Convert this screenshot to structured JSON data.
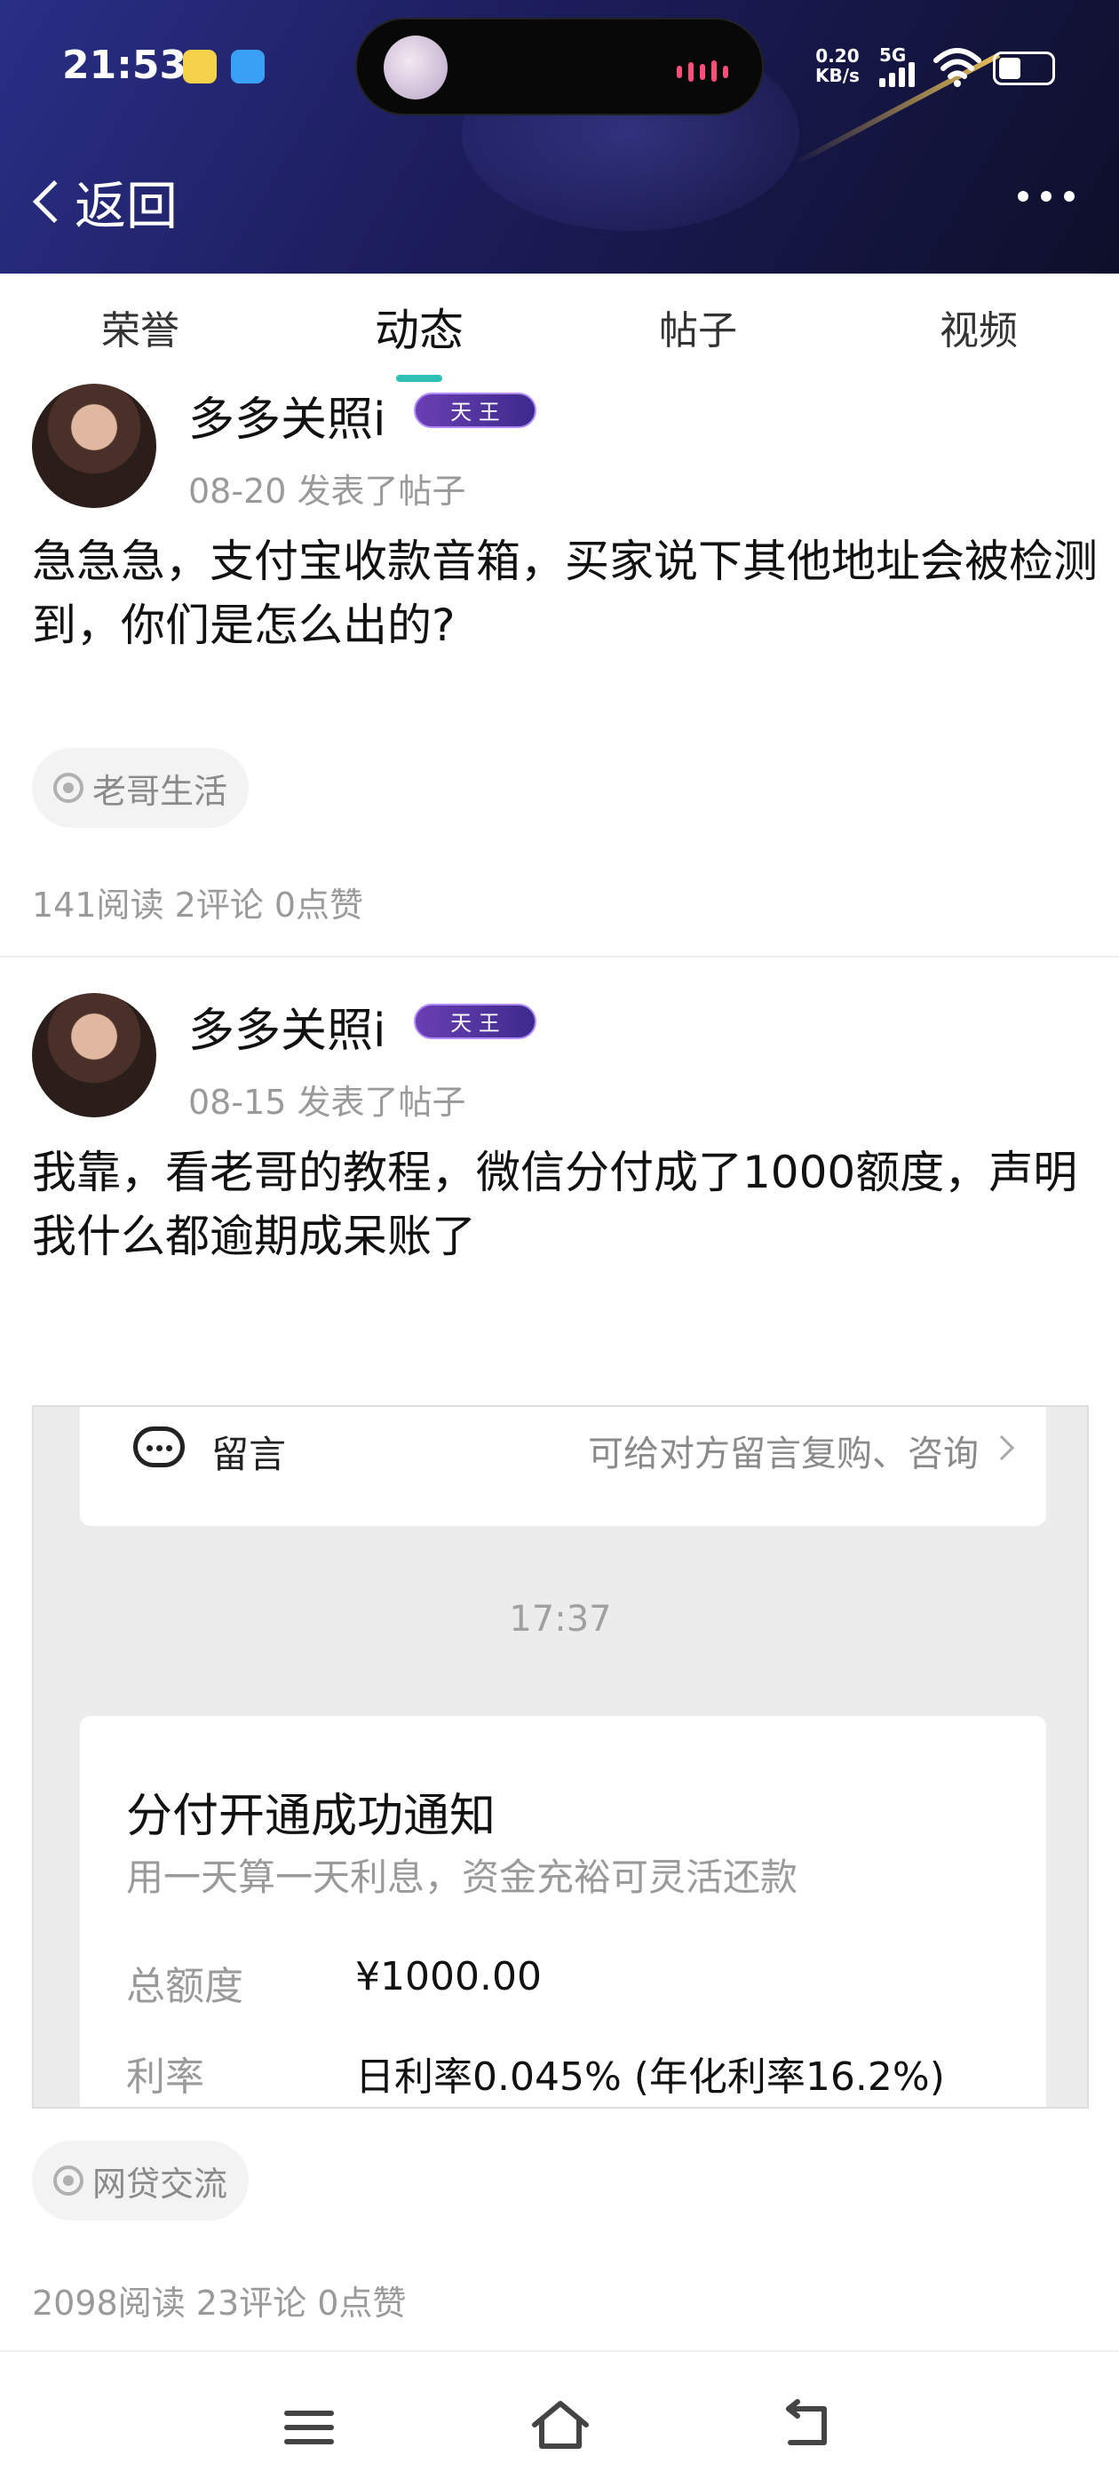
{
  "status_bar": {
    "time": "21:53",
    "net_speed_value": "0.20",
    "net_speed_unit": "KB/s",
    "signal": "5G"
  },
  "nav": {
    "back_label": "返回"
  },
  "tabs": [
    {
      "label": "荣誉"
    },
    {
      "label": "动态"
    },
    {
      "label": "帖子"
    },
    {
      "label": "视频"
    }
  ],
  "posts": [
    {
      "author": "多多关照i",
      "badge": "天 王",
      "meta": "08-20  发表了帖子",
      "content": "急急急，支付宝收款音箱，买家说下其他地址会被检测到，你们是怎么出的?",
      "tag": "老哥生活",
      "stats": "141阅读 2评论 0点赞"
    },
    {
      "author": "多多关照i",
      "badge": "天 王",
      "meta": "08-15  发表了帖子",
      "content": "我靠，看老哥的教程，微信分付成了1000额度，声明我什么都逾期成呆账了",
      "tag": "网贷交流",
      "stats": "2098阅读 23评论 0点赞"
    }
  ],
  "embedded_screenshot": {
    "message_label": "留言",
    "message_hint": "可给对方留言复购、咨询",
    "time": "17:37",
    "card_title": "分付开通成功通知",
    "card_subtitle": "用一天算一天利息，资金充裕可灵活还款",
    "rows": [
      {
        "key": "总额度",
        "value": "¥1000.00"
      },
      {
        "key": "利率",
        "value": "日利率0.045% (年化利率16.2%)"
      }
    ]
  },
  "colors": {
    "header_bg": "#1c1c5a",
    "tab_accent": "#2ec2b5",
    "badge": "#5a3aa8"
  }
}
